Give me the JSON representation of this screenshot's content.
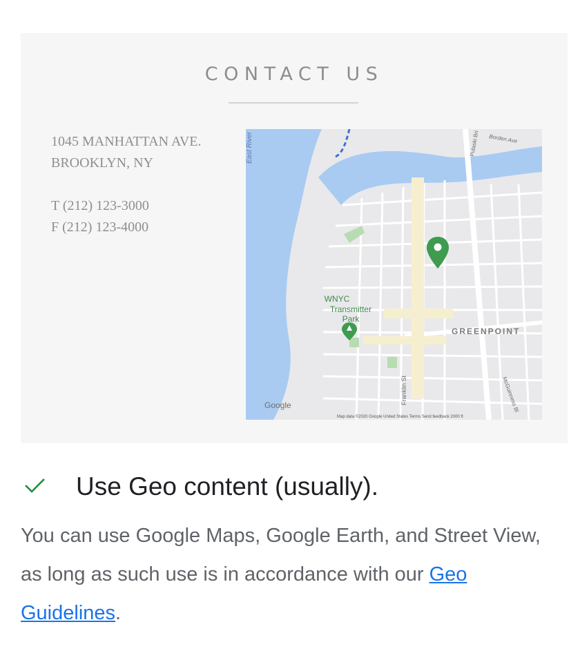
{
  "card": {
    "title": "CONTACT US",
    "address_line1": "1045 MANHATTAN AVE.",
    "address_line2": "BROOKLYN, NY",
    "phone": "T (212) 123-3000",
    "fax": "F (212) 123-4000"
  },
  "map": {
    "labels": {
      "river": "East River",
      "park": [
        "WNYC",
        "Transmitter",
        "Park"
      ],
      "neighborhood": "GREENPOINT",
      "street1": "Franklin St",
      "street2": "McGuinness Bl",
      "street3": "Pulaski Bri",
      "street4": "Borden Ave",
      "logo": "Google",
      "attribution": "Map data ©2020 Google   United States   Terms   Send feedback   2000 ft"
    },
    "colors": {
      "water": "#a8cbf2",
      "land": "#e8e8e8",
      "road": "#ffffff",
      "park": "#b7dbb0",
      "marker": "#3e9b4f"
    }
  },
  "item": {
    "check_color": "#1e8e3e",
    "heading": "Use Geo content (usually).",
    "body_prefix": "You can use Google Maps, Google Earth, and Street View, as long as such use is in accordance with our ",
    "link_text": "Geo Guidelines",
    "body_suffix": "."
  }
}
